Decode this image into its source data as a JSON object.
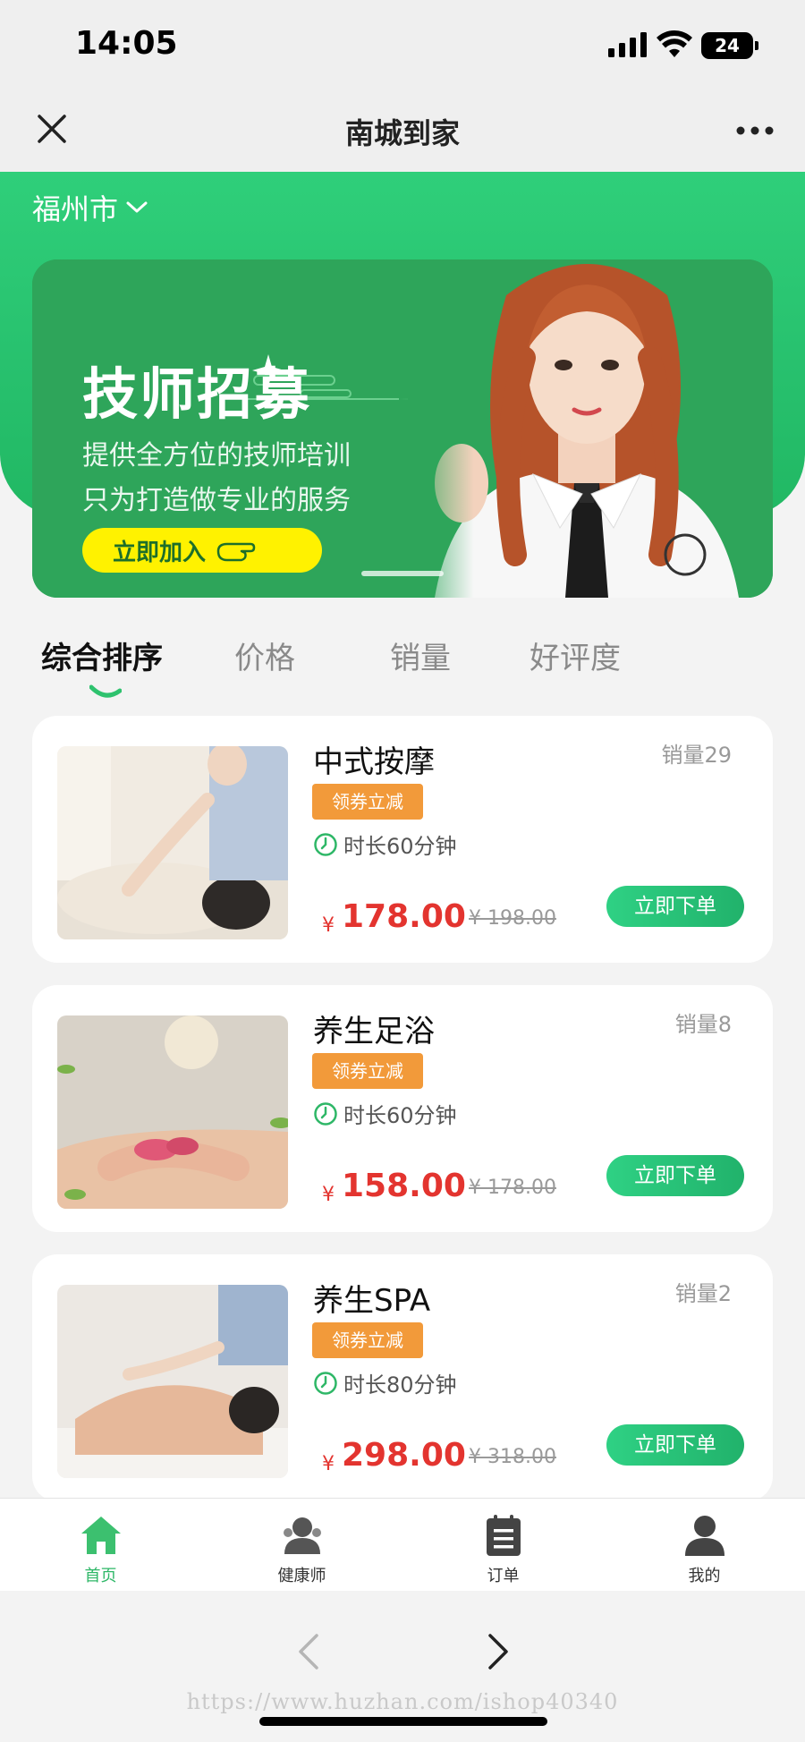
{
  "status_bar": {
    "time": "14:05",
    "battery": "24"
  },
  "nav": {
    "title": "南城到家"
  },
  "header": {
    "city": "福州市"
  },
  "banner": {
    "title": "技师招募",
    "line1": "提供全方位的技师培训",
    "line2": "只为打造做专业的服务",
    "button": "立即加入"
  },
  "sort_tabs": [
    {
      "label": "综合排序",
      "active": true
    },
    {
      "label": "价格",
      "active": false
    },
    {
      "label": "销量",
      "active": false
    },
    {
      "label": "好评度",
      "active": false
    }
  ],
  "products": [
    {
      "name": "中式按摩",
      "sales": "销量29",
      "coupon": "领券立减",
      "duration": "时长60分钟",
      "currency": "¥",
      "price": "178.00",
      "original_price": "¥ 198.00",
      "button": "立即下单"
    },
    {
      "name": "养生足浴",
      "sales": "销量8",
      "coupon": "领券立减",
      "duration": "时长60分钟",
      "currency": "¥",
      "price": "158.00",
      "original_price": "¥ 178.00",
      "button": "立即下单"
    },
    {
      "name": "养生SPA",
      "sales": "销量2",
      "coupon": "领券立减",
      "duration": "时长80分钟",
      "currency": "¥",
      "price": "298.00",
      "original_price": "¥ 318.00",
      "button": "立即下单"
    }
  ],
  "tab_bar": [
    {
      "label": "首页",
      "icon": "home-icon",
      "active": true
    },
    {
      "label": "健康师",
      "icon": "therapist-icon",
      "active": false
    },
    {
      "label": "订单",
      "icon": "order-icon",
      "active": false
    },
    {
      "label": "我的",
      "icon": "profile-icon",
      "active": false
    }
  ],
  "watermark": "https://www.huzhan.com/ishop40340",
  "colors": {
    "brand_green": "#27c06d",
    "price_red": "#e3342f",
    "coupon_orange": "#f29a3a",
    "join_yellow": "#fff200"
  }
}
